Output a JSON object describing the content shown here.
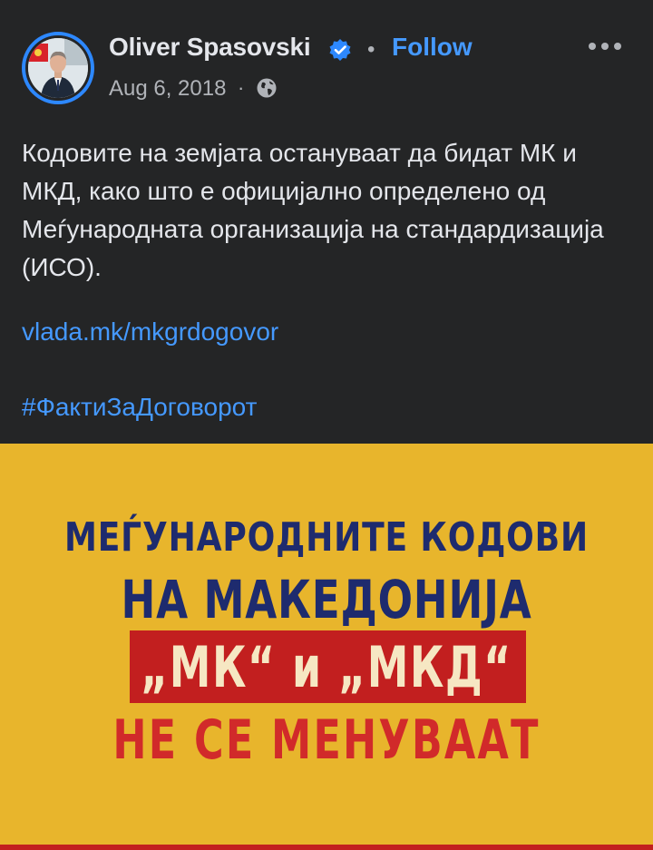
{
  "post": {
    "author_name": "Oliver Spasovski",
    "separator": "•",
    "follow_label": "Follow",
    "date": "Aug 6, 2018",
    "date_separator": "·",
    "privacy_icon": "globe-icon",
    "verified_icon": "verified-badge-icon",
    "more_icon": "more-options-icon",
    "text_paragraph": "Кодовите на земјата остануваат да бидат МК и МКД, како што е официјално определено од Меѓународната организација на стандардизација (ИСО).",
    "link": "vlada.mk/mkgrdogovor",
    "hashtag": "#ФактиЗаДоговорот"
  },
  "image": {
    "line1": "МЕЃУНАРОДНИТЕ КОДОВИ",
    "line2": "НА МАКЕДОНИЈА",
    "line3": "„МК“ и „МКД“",
    "line4": "НЕ СЕ МЕНУВААТ",
    "background_color": "#e8b52c",
    "navy_color": "#1e2b6e",
    "red_color": "#c21f1f"
  },
  "colors": {
    "background": "#242526",
    "link": "#4599ff",
    "text": "#e4e6eb",
    "secondary_text": "#b0b3b8",
    "avatar_ring": "#2d88ff"
  }
}
